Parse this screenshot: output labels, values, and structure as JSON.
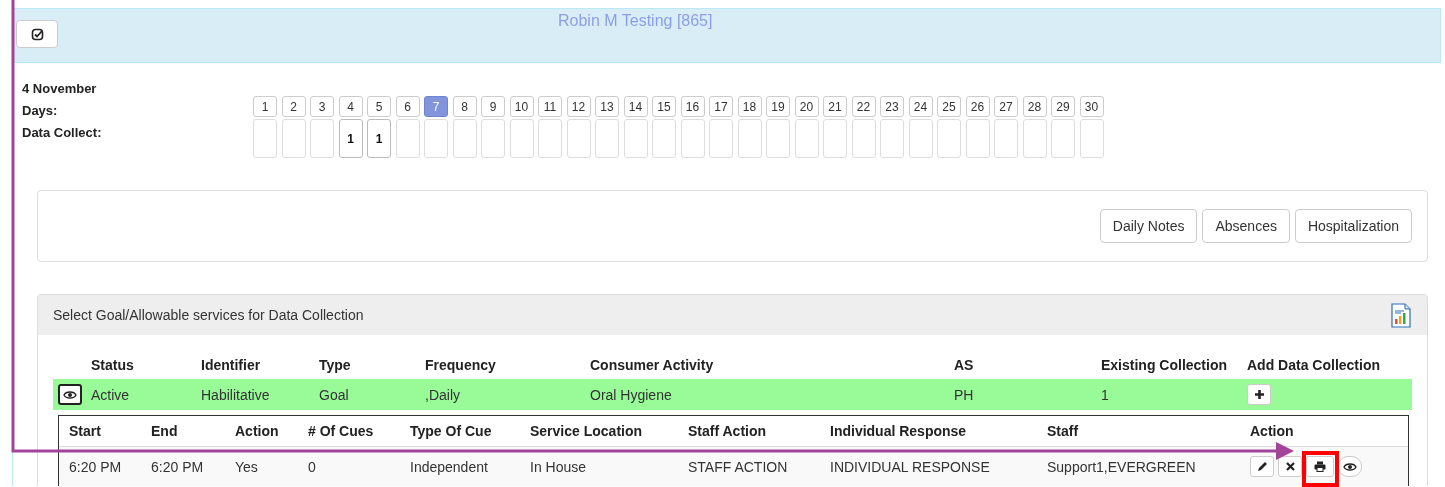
{
  "header": {
    "title": "Robin M Testing [865]"
  },
  "date_label": "4 November",
  "days_label": "Days:",
  "data_collect_label": "Data Collect:",
  "days": [
    {
      "label": "1",
      "selected": false
    },
    {
      "label": "2",
      "selected": false
    },
    {
      "label": "3",
      "selected": false
    },
    {
      "label": "4",
      "selected": false,
      "count": "1"
    },
    {
      "label": "5",
      "selected": false,
      "count": "1"
    },
    {
      "label": "6",
      "selected": false
    },
    {
      "label": "7",
      "selected": true
    },
    {
      "label": "8",
      "selected": false
    },
    {
      "label": "9",
      "selected": false
    },
    {
      "label": "10",
      "selected": false
    },
    {
      "label": "11",
      "selected": false
    },
    {
      "label": "12",
      "selected": false
    },
    {
      "label": "13",
      "selected": false
    },
    {
      "label": "14",
      "selected": false
    },
    {
      "label": "15",
      "selected": false
    },
    {
      "label": "16",
      "selected": false
    },
    {
      "label": "17",
      "selected": false
    },
    {
      "label": "18",
      "selected": false
    },
    {
      "label": "19",
      "selected": false
    },
    {
      "label": "20",
      "selected": false
    },
    {
      "label": "21",
      "selected": false
    },
    {
      "label": "22",
      "selected": false
    },
    {
      "label": "23",
      "selected": false
    },
    {
      "label": "24",
      "selected": false
    },
    {
      "label": "25",
      "selected": false
    },
    {
      "label": "26",
      "selected": false
    },
    {
      "label": "27",
      "selected": false
    },
    {
      "label": "28",
      "selected": false
    },
    {
      "label": "29",
      "selected": false
    },
    {
      "label": "30",
      "selected": false
    }
  ],
  "buttons": [
    "Daily Notes",
    "Absences",
    "Hospitalization"
  ],
  "goals": {
    "title": "Select Goal/Allowable services for Data Collection",
    "columns": [
      "Status",
      "Identifier",
      "Type",
      "Frequency",
      "Consumer Activity",
      "AS",
      "Existing Collection",
      "Add Data Collection"
    ],
    "rows": [
      {
        "status": "Active",
        "identifier": "Habilitative",
        "type": "Goal",
        "frequency": ",Daily",
        "consumer_activity": "Oral Hygiene",
        "as": "PH",
        "existing_collection": "1"
      }
    ],
    "collections": {
      "columns": [
        "Start",
        "End",
        "Action",
        "# Of Cues",
        "Type Of Cue",
        "Service Location",
        "Staff Action",
        "Individual Response",
        "Staff",
        "Action"
      ],
      "rows": [
        {
          "start": "6:20 PM",
          "end": "6:20 PM",
          "action": "Yes",
          "cues": "0",
          "type_of_cue": "Independent",
          "service_location": "In House",
          "staff_action": "STAFF ACTION",
          "individual_response": "INDIVIDUAL RESPONSE",
          "staff": "Support1,EVERGREEN"
        }
      ]
    }
  }
}
